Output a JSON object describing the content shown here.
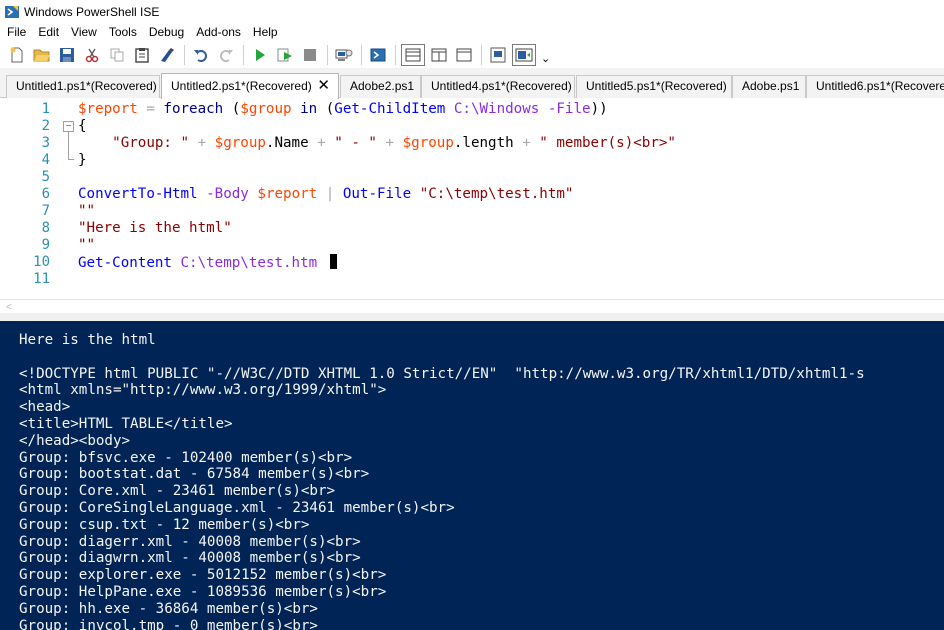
{
  "window": {
    "title": "Windows PowerShell ISE"
  },
  "menu": [
    "File",
    "Edit",
    "View",
    "Tools",
    "Debug",
    "Add-ons",
    "Help"
  ],
  "toolbar": {
    "buttons": [
      "new-file",
      "open",
      "save",
      "cut",
      "copy",
      "paste",
      "clear-console",
      "undo",
      "redo",
      "run-script",
      "run-selection",
      "stop",
      "new-remote-tab",
      "start-powershell",
      "show-script-top",
      "show-script-right",
      "show-script-max",
      "show-command-window",
      "show-addon-pane"
    ],
    "overflow": "⌄"
  },
  "tabs": [
    {
      "label": "Untitled1.ps1*(Recovered)",
      "active": false
    },
    {
      "label": "Untitled2.ps1*(Recovered)",
      "active": true,
      "close": "✕"
    },
    {
      "label": "Adobe2.ps1",
      "active": false
    },
    {
      "label": "Untitled4.ps1*(Recovered)",
      "active": false
    },
    {
      "label": "Untitled5.ps1*(Recovered)",
      "active": false
    },
    {
      "label": "Adobe.ps1",
      "active": false
    },
    {
      "label": "Untitled6.ps1*(Recovered)",
      "active": false
    }
  ],
  "editor": {
    "line_numbers": [
      "1",
      "2",
      "3",
      "4",
      "5",
      "6",
      "7",
      "8",
      "9",
      "10",
      "11"
    ],
    "lines": [
      [
        [
          "var",
          "$report"
        ],
        [
          "op",
          " = "
        ],
        [
          "kw",
          "foreach"
        ],
        [
          "par",
          " ("
        ],
        [
          "var",
          "$group"
        ],
        [
          "kw",
          " in "
        ],
        [
          "par",
          "("
        ],
        [
          "cmd",
          "Get-ChildItem"
        ],
        [
          "arg",
          " C:\\Windows"
        ],
        [
          "op",
          " "
        ],
        [
          "arg",
          "-File"
        ],
        [
          "par",
          "))"
        ]
      ],
      [
        [
          "par",
          "{"
        ]
      ],
      [
        [
          "par",
          "    "
        ],
        [
          "str",
          "\"Group: \""
        ],
        [
          "op",
          " + "
        ],
        [
          "var",
          "$group"
        ],
        [
          "prop",
          ".Name"
        ],
        [
          "op",
          " + "
        ],
        [
          "str",
          "\" - \""
        ],
        [
          "op",
          " + "
        ],
        [
          "var",
          "$group"
        ],
        [
          "prop",
          ".length"
        ],
        [
          "op",
          " + "
        ],
        [
          "str",
          "\" member(s)<br>\""
        ]
      ],
      [
        [
          "par",
          "}"
        ]
      ],
      [],
      [
        [
          "cmd",
          "ConvertTo-Html"
        ],
        [
          "op",
          " "
        ],
        [
          "arg",
          "-Body"
        ],
        [
          "op",
          " "
        ],
        [
          "var",
          "$report"
        ],
        [
          "op",
          " | "
        ],
        [
          "cmd",
          "Out-File"
        ],
        [
          "op",
          " "
        ],
        [
          "str",
          "\"C:\\temp\\test.htm\""
        ]
      ],
      [
        [
          "str",
          "\"\""
        ]
      ],
      [
        [
          "str",
          "\"Here is the html\""
        ]
      ],
      [
        [
          "str",
          "\"\""
        ]
      ],
      [
        [
          "cmd",
          "Get-Content"
        ],
        [
          "op",
          " "
        ],
        [
          "arg",
          "C:\\temp\\test.htm"
        ],
        [
          "op",
          " "
        ]
      ],
      []
    ]
  },
  "console": {
    "lines": [
      "Here is the html",
      "",
      "<!DOCTYPE html PUBLIC \"-//W3C//DTD XHTML 1.0 Strict//EN\"  \"http://www.w3.org/TR/xhtml1/DTD/xhtml1-s",
      "<html xmlns=\"http://www.w3.org/1999/xhtml\">",
      "<head>",
      "<title>HTML TABLE</title>",
      "</head><body>",
      "Group: bfsvc.exe - 102400 member(s)<br>",
      "Group: bootstat.dat - 67584 member(s)<br>",
      "Group: Core.xml - 23461 member(s)<br>",
      "Group: CoreSingleLanguage.xml - 23461 member(s)<br>",
      "Group: csup.txt - 12 member(s)<br>",
      "Group: diagerr.xml - 40008 member(s)<br>",
      "Group: diagwrn.xml - 40008 member(s)<br>",
      "Group: explorer.exe - 5012152 member(s)<br>",
      "Group: HelpPane.exe - 1089536 member(s)<br>",
      "Group: hh.exe - 36864 member(s)<br>",
      "Group: inycol.tmp - 0 member(s)<br>"
    ]
  },
  "colors": {
    "console_bg": "#012456",
    "console_fg": "#f5f5f5",
    "line_number": "#2b91af",
    "keyword": "#00008b",
    "variable": "#ff4500",
    "command": "#0000ff",
    "string": "#8b0000",
    "argument": "#8a2be2"
  }
}
